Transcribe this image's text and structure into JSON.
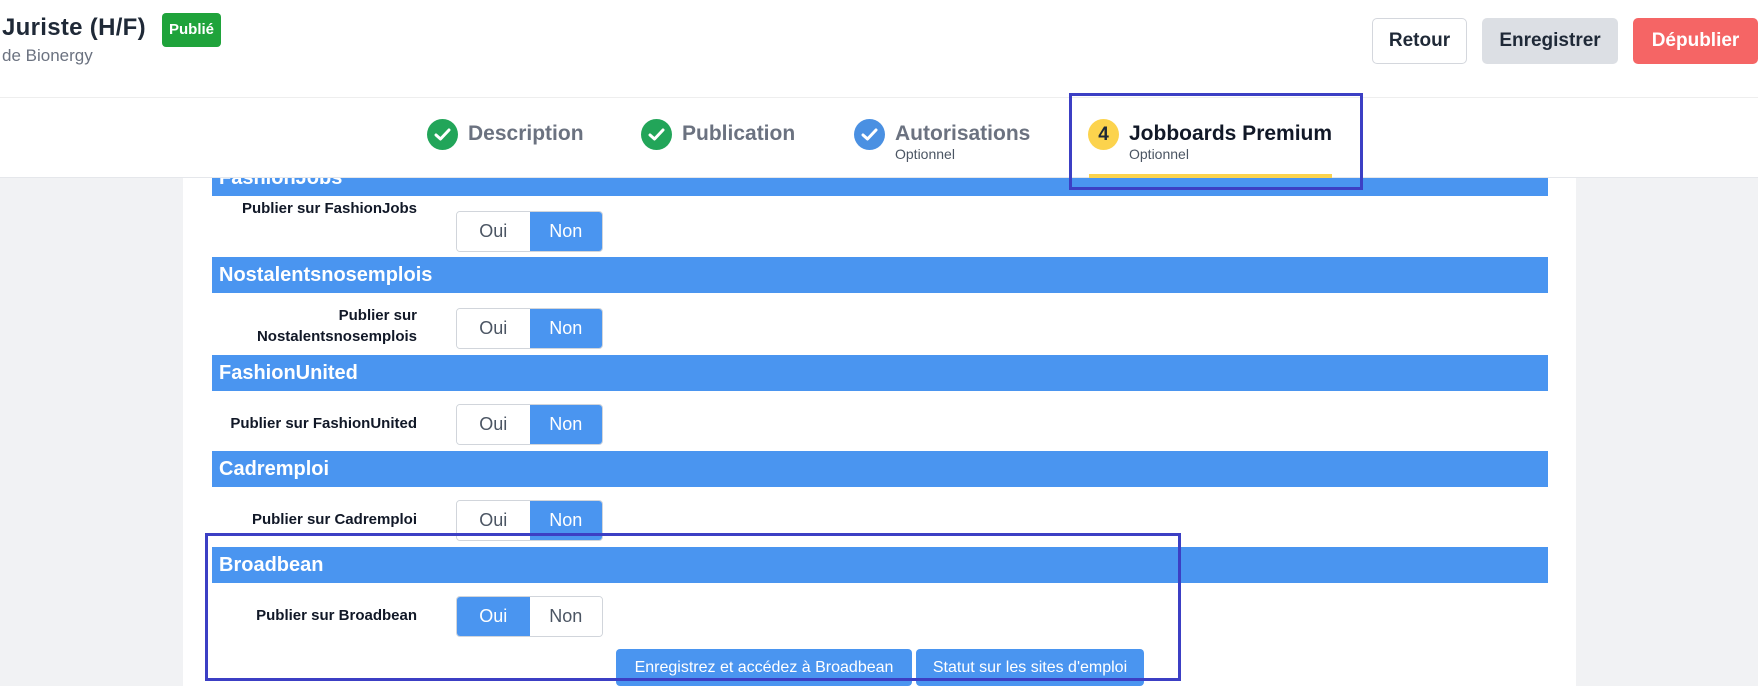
{
  "header": {
    "title": "Juriste (H/F)",
    "badge": "Publié",
    "subtitle": "de Bionergy",
    "buttons": {
      "retour": "Retour",
      "enregistrer": "Enregistrer",
      "depublier": "Dépublier"
    }
  },
  "stepper": {
    "steps": [
      {
        "label": "Description",
        "sub": "",
        "state": "done",
        "icon": "check-icon"
      },
      {
        "label": "Publication",
        "sub": "",
        "state": "done",
        "icon": "check-icon"
      },
      {
        "label": "Autorisations",
        "sub": "Optionnel",
        "state": "done",
        "icon": "check-icon"
      },
      {
        "label": "Jobboards Premium",
        "sub": "Optionnel",
        "state": "active",
        "number": "4"
      }
    ]
  },
  "sections": [
    {
      "title": "FashionJobs",
      "field_label": "Publier sur FashionJobs",
      "yes": "Oui",
      "no": "Non",
      "selected": "Non"
    },
    {
      "title": "Nostalentsnosemplois",
      "field_label": "Publier sur Nostalentsnosemplois",
      "yes": "Oui",
      "no": "Non",
      "selected": "Non"
    },
    {
      "title": "FashionUnited",
      "field_label": "Publier sur FashionUnited",
      "yes": "Oui",
      "no": "Non",
      "selected": "Non"
    },
    {
      "title": "Cadremploi",
      "field_label": "Publier sur Cadremploi",
      "yes": "Oui",
      "no": "Non",
      "selected": "Non"
    },
    {
      "title": "Broadbean",
      "field_label": "Publier sur Broadbean",
      "yes": "Oui",
      "no": "Non",
      "selected": "Oui"
    }
  ],
  "broadbean_actions": {
    "save_access": "Enregistrez et accédez à Broadbean",
    "status": "Statut sur les sites d'emploi"
  },
  "colors": {
    "accent": "#4a95f0",
    "published_badge": "#1fa33b",
    "danger": "#f56565",
    "step_active": "#fcd34d",
    "annotation": "#3c3fc4"
  }
}
